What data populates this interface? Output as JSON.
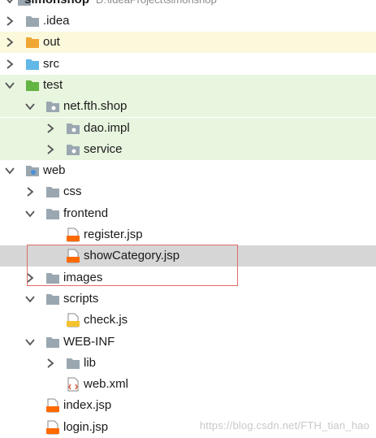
{
  "root": {
    "name": "simonshop",
    "path": "D:\\IdeaProject\\simonshop"
  },
  "tree": [
    {
      "label": ".idea",
      "indent": 0,
      "arrow": "right",
      "icon": "folder",
      "bg": ""
    },
    {
      "label": "out",
      "indent": 0,
      "arrow": "right",
      "icon": "folder-orange",
      "bg": "out-bg"
    },
    {
      "label": "src",
      "indent": 0,
      "arrow": "right",
      "icon": "folder-blue",
      "bg": ""
    },
    {
      "label": "test",
      "indent": 0,
      "arrow": "down",
      "icon": "folder-green",
      "bg": "test-bg"
    },
    {
      "label": "net.fth.shop",
      "indent": 1,
      "arrow": "down",
      "icon": "package",
      "bg": "test-bg"
    },
    {
      "label": "dao.impl",
      "indent": 2,
      "arrow": "right",
      "icon": "package",
      "bg": "test-bg"
    },
    {
      "label": "service",
      "indent": 2,
      "arrow": "right",
      "icon": "package",
      "bg": "test-bg"
    },
    {
      "label": "web",
      "indent": 0,
      "arrow": "down",
      "icon": "folder-web",
      "bg": ""
    },
    {
      "label": "css",
      "indent": 1,
      "arrow": "right",
      "icon": "folder",
      "bg": ""
    },
    {
      "label": "frontend",
      "indent": 1,
      "arrow": "down",
      "icon": "folder",
      "bg": ""
    },
    {
      "label": "register.jsp",
      "indent": 2,
      "arrow": "",
      "icon": "jsp",
      "bg": ""
    },
    {
      "label": "showCategory.jsp",
      "indent": 2,
      "arrow": "",
      "icon": "jsp",
      "bg": "selected"
    },
    {
      "label": "images",
      "indent": 1,
      "arrow": "right",
      "icon": "folder",
      "bg": ""
    },
    {
      "label": "scripts",
      "indent": 1,
      "arrow": "down",
      "icon": "folder",
      "bg": ""
    },
    {
      "label": "check.js",
      "indent": 2,
      "arrow": "",
      "icon": "js",
      "bg": ""
    },
    {
      "label": "WEB-INF",
      "indent": 1,
      "arrow": "down",
      "icon": "folder",
      "bg": ""
    },
    {
      "label": "lib",
      "indent": 2,
      "arrow": "right",
      "icon": "folder",
      "bg": ""
    },
    {
      "label": "web.xml",
      "indent": 2,
      "arrow": "",
      "icon": "xml",
      "bg": ""
    },
    {
      "label": "index.jsp",
      "indent": 1,
      "arrow": "",
      "icon": "jsp",
      "bg": ""
    },
    {
      "label": "login.jsp",
      "indent": 1,
      "arrow": "",
      "icon": "jsp",
      "bg": ""
    }
  ],
  "watermark": "https://blog.csdn.net/FTH_tian_hao",
  "colors": {
    "folder": "#9aa7b0",
    "folder_orange": "#f0a732",
    "folder_blue": "#62b8e6",
    "folder_green": "#62b543",
    "jsp": "#ff6a00",
    "js": "#f4c430",
    "selected": "#d6d6d6",
    "test_bg": "#e8f5df",
    "out_bg": "#fbf8dc",
    "highlight": "#e06b6b"
  }
}
